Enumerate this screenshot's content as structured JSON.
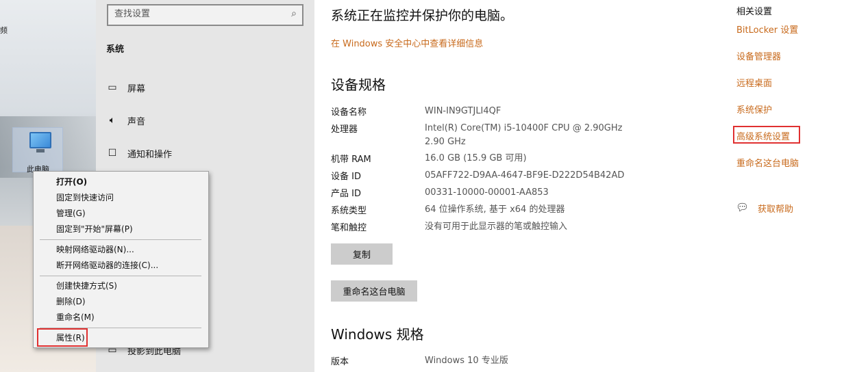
{
  "desktop": {
    "top_label": "频",
    "icon_label": "此电脑"
  },
  "nav": {
    "search_placeholder": "查找设置",
    "heading": "系统",
    "items": [
      {
        "label": "屏幕",
        "icon": "monitor-icon"
      },
      {
        "label": "声音",
        "icon": "speaker-icon"
      },
      {
        "label": "通知和操作",
        "icon": "notification-icon"
      },
      {
        "label": "投影到此电脑",
        "icon": "project-icon"
      }
    ]
  },
  "context_menu": {
    "items": [
      {
        "label": "打开(O)"
      },
      {
        "label": "固定到快速访问"
      },
      {
        "label": "管理(G)"
      },
      {
        "label": "固定到\"开始\"屏幕(P)"
      },
      {
        "label": "映射网络驱动器(N)..."
      },
      {
        "label": "断开网络驱动器的连接(C)..."
      },
      {
        "label": "创建快捷方式(S)"
      },
      {
        "label": "删除(D)"
      },
      {
        "label": "重命名(M)"
      },
      {
        "label": "属性(R)"
      }
    ]
  },
  "main": {
    "status": "系统正在监控并保护你的电脑。",
    "security_link": "在 Windows 安全中心中查看详细信息",
    "device_specs_heading": "设备规格",
    "specs": [
      {
        "key": "设备名称",
        "value": "WIN-IN9GTJLI4QF"
      },
      {
        "key": "处理器",
        "value": "Intel(R) Core(TM) i5-10400F CPU @ 2.90GHz   2.90 GHz"
      },
      {
        "key": "机带 RAM",
        "value": "16.0 GB (15.9 GB 可用)"
      },
      {
        "key": "设备 ID",
        "value": "05AFF722-D9AA-4647-BF9E-D222D54B42AD"
      },
      {
        "key": "产品 ID",
        "value": "00331-10000-00001-AA853"
      },
      {
        "key": "系统类型",
        "value": "64 位操作系统, 基于 x64 的处理器"
      },
      {
        "key": "笔和触控",
        "value": "没有可用于此显示器的笔或触控输入"
      }
    ],
    "copy_button": "复制",
    "rename_button": "重命名这台电脑",
    "windows_specs_heading": "Windows 规格",
    "edition_key": "版本",
    "edition_value": "Windows 10 专业版"
  },
  "related": {
    "heading": "相关设置",
    "links": [
      "BitLocker 设置",
      "设备管理器",
      "远程桌面",
      "系统保护",
      "高级系统设置",
      "重命名这台电脑"
    ],
    "help": "获取帮助"
  },
  "colors": {
    "link": "#c86a1c",
    "highlight_box": "#e03030",
    "nav_bg": "#e6e6e6",
    "button_bg": "#cccccc"
  }
}
